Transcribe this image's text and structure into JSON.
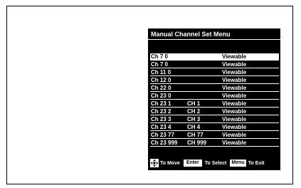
{
  "menu": {
    "title": "Manual Channel Set Menu",
    "rows": [
      {
        "channel": "Ch 7 0",
        "subchannel": "",
        "status": "Viewable",
        "selected": true
      },
      {
        "channel": "Ch 7 0",
        "subchannel": "",
        "status": "Viewable",
        "selected": false
      },
      {
        "channel": "Ch 11 0",
        "subchannel": "",
        "status": "Viewable",
        "selected": false
      },
      {
        "channel": "Ch 12 0",
        "subchannel": "",
        "status": "Viewable",
        "selected": false
      },
      {
        "channel": "Ch 22 0",
        "subchannel": "",
        "status": "Viewable",
        "selected": false
      },
      {
        "channel": "Ch 23 0",
        "subchannel": "",
        "status": "Viewable",
        "selected": false
      },
      {
        "channel": "Ch 23 1",
        "subchannel": "CH 1",
        "status": "Viewable",
        "selected": false
      },
      {
        "channel": "Ch 23 2",
        "subchannel": "CH 2",
        "status": "Viewable",
        "selected": false
      },
      {
        "channel": "Ch 23 3",
        "subchannel": "CH 3",
        "status": "Viewable",
        "selected": false
      },
      {
        "channel": "Ch 23 4",
        "subchannel": "CH 4",
        "status": "Viewable",
        "selected": false
      },
      {
        "channel": "Ch 23 77",
        "subchannel": "CH 77",
        "status": "Viewable",
        "selected": false
      },
      {
        "channel": "Ch 23 999",
        "subchannel": "CH 999",
        "status": "Viewable",
        "selected": false
      }
    ]
  },
  "help": {
    "move_icon": "four-way-arrow-icon",
    "move_text": "To Move",
    "enter_key": "Enter",
    "select_text": "To Select",
    "menu_key": "Menu",
    "exit_text": "To Exit"
  },
  "colors": {
    "osd_background": "#000000",
    "osd_text": "#ffffff",
    "highlight": "#ffffff"
  }
}
